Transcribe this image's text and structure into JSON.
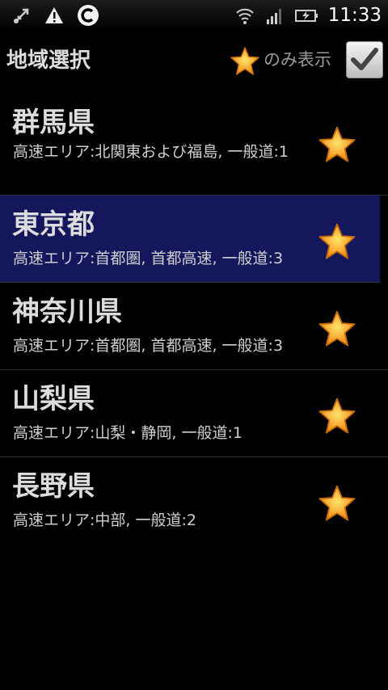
{
  "status": {
    "time": "11:33",
    "icons": [
      "usb-debug-icon",
      "warning-icon",
      "c-badge-icon",
      "wifi-icon",
      "signal-icon",
      "battery-charging-icon"
    ]
  },
  "header": {
    "title": "地域選択",
    "filter_label": "のみ表示",
    "filter_checked": true
  },
  "colors": {
    "background": "#000000",
    "selected_row": "#15175d",
    "star_fill": "#f7a21a",
    "text": "#dcdcdc"
  },
  "regions": [
    {
      "name": "群馬県",
      "detail": "高速エリア:北関東および福島, 一般道:1",
      "selected": false,
      "favorite": true
    },
    {
      "name": "東京都",
      "detail": "高速エリア:首都圏, 首都高速, 一般道:3",
      "selected": true,
      "favorite": true
    },
    {
      "name": "神奈川県",
      "detail": "高速エリア:首都圏, 首都高速, 一般道:3",
      "selected": false,
      "favorite": true
    },
    {
      "name": "山梨県",
      "detail": "高速エリア:山梨・静岡, 一般道:1",
      "selected": false,
      "favorite": true
    },
    {
      "name": "長野県",
      "detail": "高速エリア:中部, 一般道:2",
      "selected": false,
      "favorite": true
    }
  ]
}
